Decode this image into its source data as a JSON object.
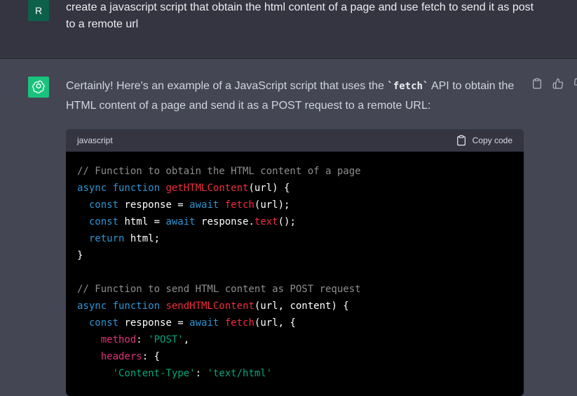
{
  "user": {
    "avatar_letter": "R",
    "message": "create a javascript script that obtain the html content of a page and use fetch to send it as post to a remote url"
  },
  "assistant": {
    "intro_before": "Certainly! Here's an example of a JavaScript script that uses the ",
    "intro_code": "`fetch`",
    "intro_after": " API to obtain the HTML content of a page and send it as a POST request to a remote URL:",
    "actions": [
      "clipboard-icon",
      "thumbs-up-icon",
      "thumbs-down-icon"
    ]
  },
  "code_block": {
    "language": "javascript",
    "copy_label": "Copy code",
    "lines": [
      [
        {
          "t": "// Function to obtain the HTML content of a page",
          "c": "comment"
        }
      ],
      [
        {
          "t": "async function ",
          "c": "keyword"
        },
        {
          "t": "getHTMLContent",
          "c": "func"
        },
        {
          "t": "(url) {",
          "c": "plain"
        }
      ],
      [
        {
          "t": "  const ",
          "c": "keyword"
        },
        {
          "t": "response = ",
          "c": "plain"
        },
        {
          "t": "await ",
          "c": "keyword"
        },
        {
          "t": "fetch",
          "c": "func"
        },
        {
          "t": "(url);",
          "c": "plain"
        }
      ],
      [
        {
          "t": "  const ",
          "c": "keyword"
        },
        {
          "t": "html = ",
          "c": "plain"
        },
        {
          "t": "await ",
          "c": "keyword"
        },
        {
          "t": "response.",
          "c": "plain"
        },
        {
          "t": "text",
          "c": "func"
        },
        {
          "t": "();",
          "c": "plain"
        }
      ],
      [
        {
          "t": "  return ",
          "c": "keyword"
        },
        {
          "t": "html;",
          "c": "plain"
        }
      ],
      [
        {
          "t": "}",
          "c": "plain"
        }
      ],
      [
        {
          "t": "",
          "c": "plain"
        }
      ],
      [
        {
          "t": "// Function to send HTML content as POST request",
          "c": "comment"
        }
      ],
      [
        {
          "t": "async function ",
          "c": "keyword"
        },
        {
          "t": "sendHTMLContent",
          "c": "func"
        },
        {
          "t": "(url, content) {",
          "c": "plain"
        }
      ],
      [
        {
          "t": "  const ",
          "c": "keyword"
        },
        {
          "t": "response = ",
          "c": "plain"
        },
        {
          "t": "await ",
          "c": "keyword"
        },
        {
          "t": "fetch",
          "c": "func"
        },
        {
          "t": "(url, {",
          "c": "plain"
        }
      ],
      [
        {
          "t": "    method",
          "c": "prop"
        },
        {
          "t": ": ",
          "c": "plain"
        },
        {
          "t": "'POST'",
          "c": "string"
        },
        {
          "t": ",",
          "c": "plain"
        }
      ],
      [
        {
          "t": "    headers",
          "c": "prop"
        },
        {
          "t": ": {",
          "c": "plain"
        }
      ],
      [
        {
          "t": "      'Content-Type'",
          "c": "string"
        },
        {
          "t": ": ",
          "c": "plain"
        },
        {
          "t": "'text/html'",
          "c": "string"
        }
      ]
    ]
  },
  "colors": {
    "user_bg": "#343541",
    "assistant_bg": "#444654",
    "user_avatar": "#0d6049",
    "gpt_avatar": "#19c37d",
    "code_bg": "#000000"
  }
}
